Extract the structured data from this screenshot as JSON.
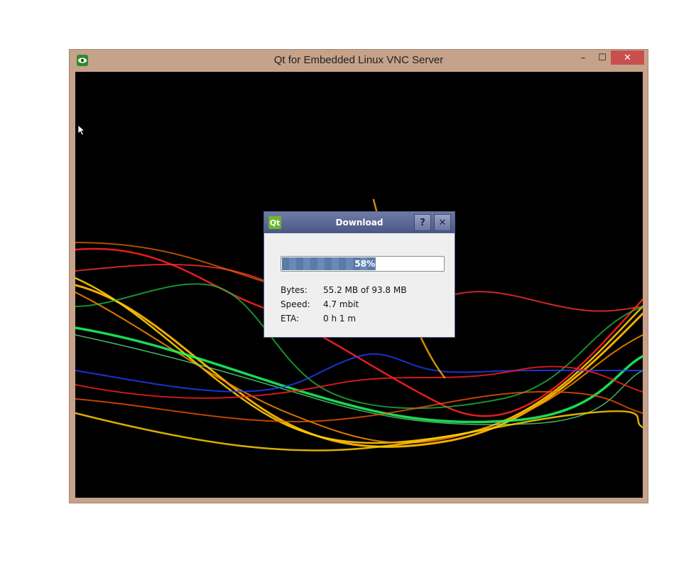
{
  "window": {
    "title": "Qt for Embedded Linux VNC Server",
    "icon": "eye-icon",
    "controls": {
      "minimize": "–",
      "maximize": "☐",
      "close": "✕"
    },
    "close_color": "#c7504f",
    "frame_color": "#c6a28a"
  },
  "dialog": {
    "title": "Download",
    "logo": "Qt",
    "help_label": "?",
    "close_label": "✕",
    "progress": {
      "value": 58,
      "label": "58%"
    },
    "rows": [
      {
        "label": "Bytes:",
        "value": "55.2 MB of 93.8 MB"
      },
      {
        "label": "Speed:",
        "value": "4.7 mbit"
      },
      {
        "label": "ETA:",
        "value": "0 h 1 m"
      }
    ],
    "title_color": "#4a5787"
  }
}
